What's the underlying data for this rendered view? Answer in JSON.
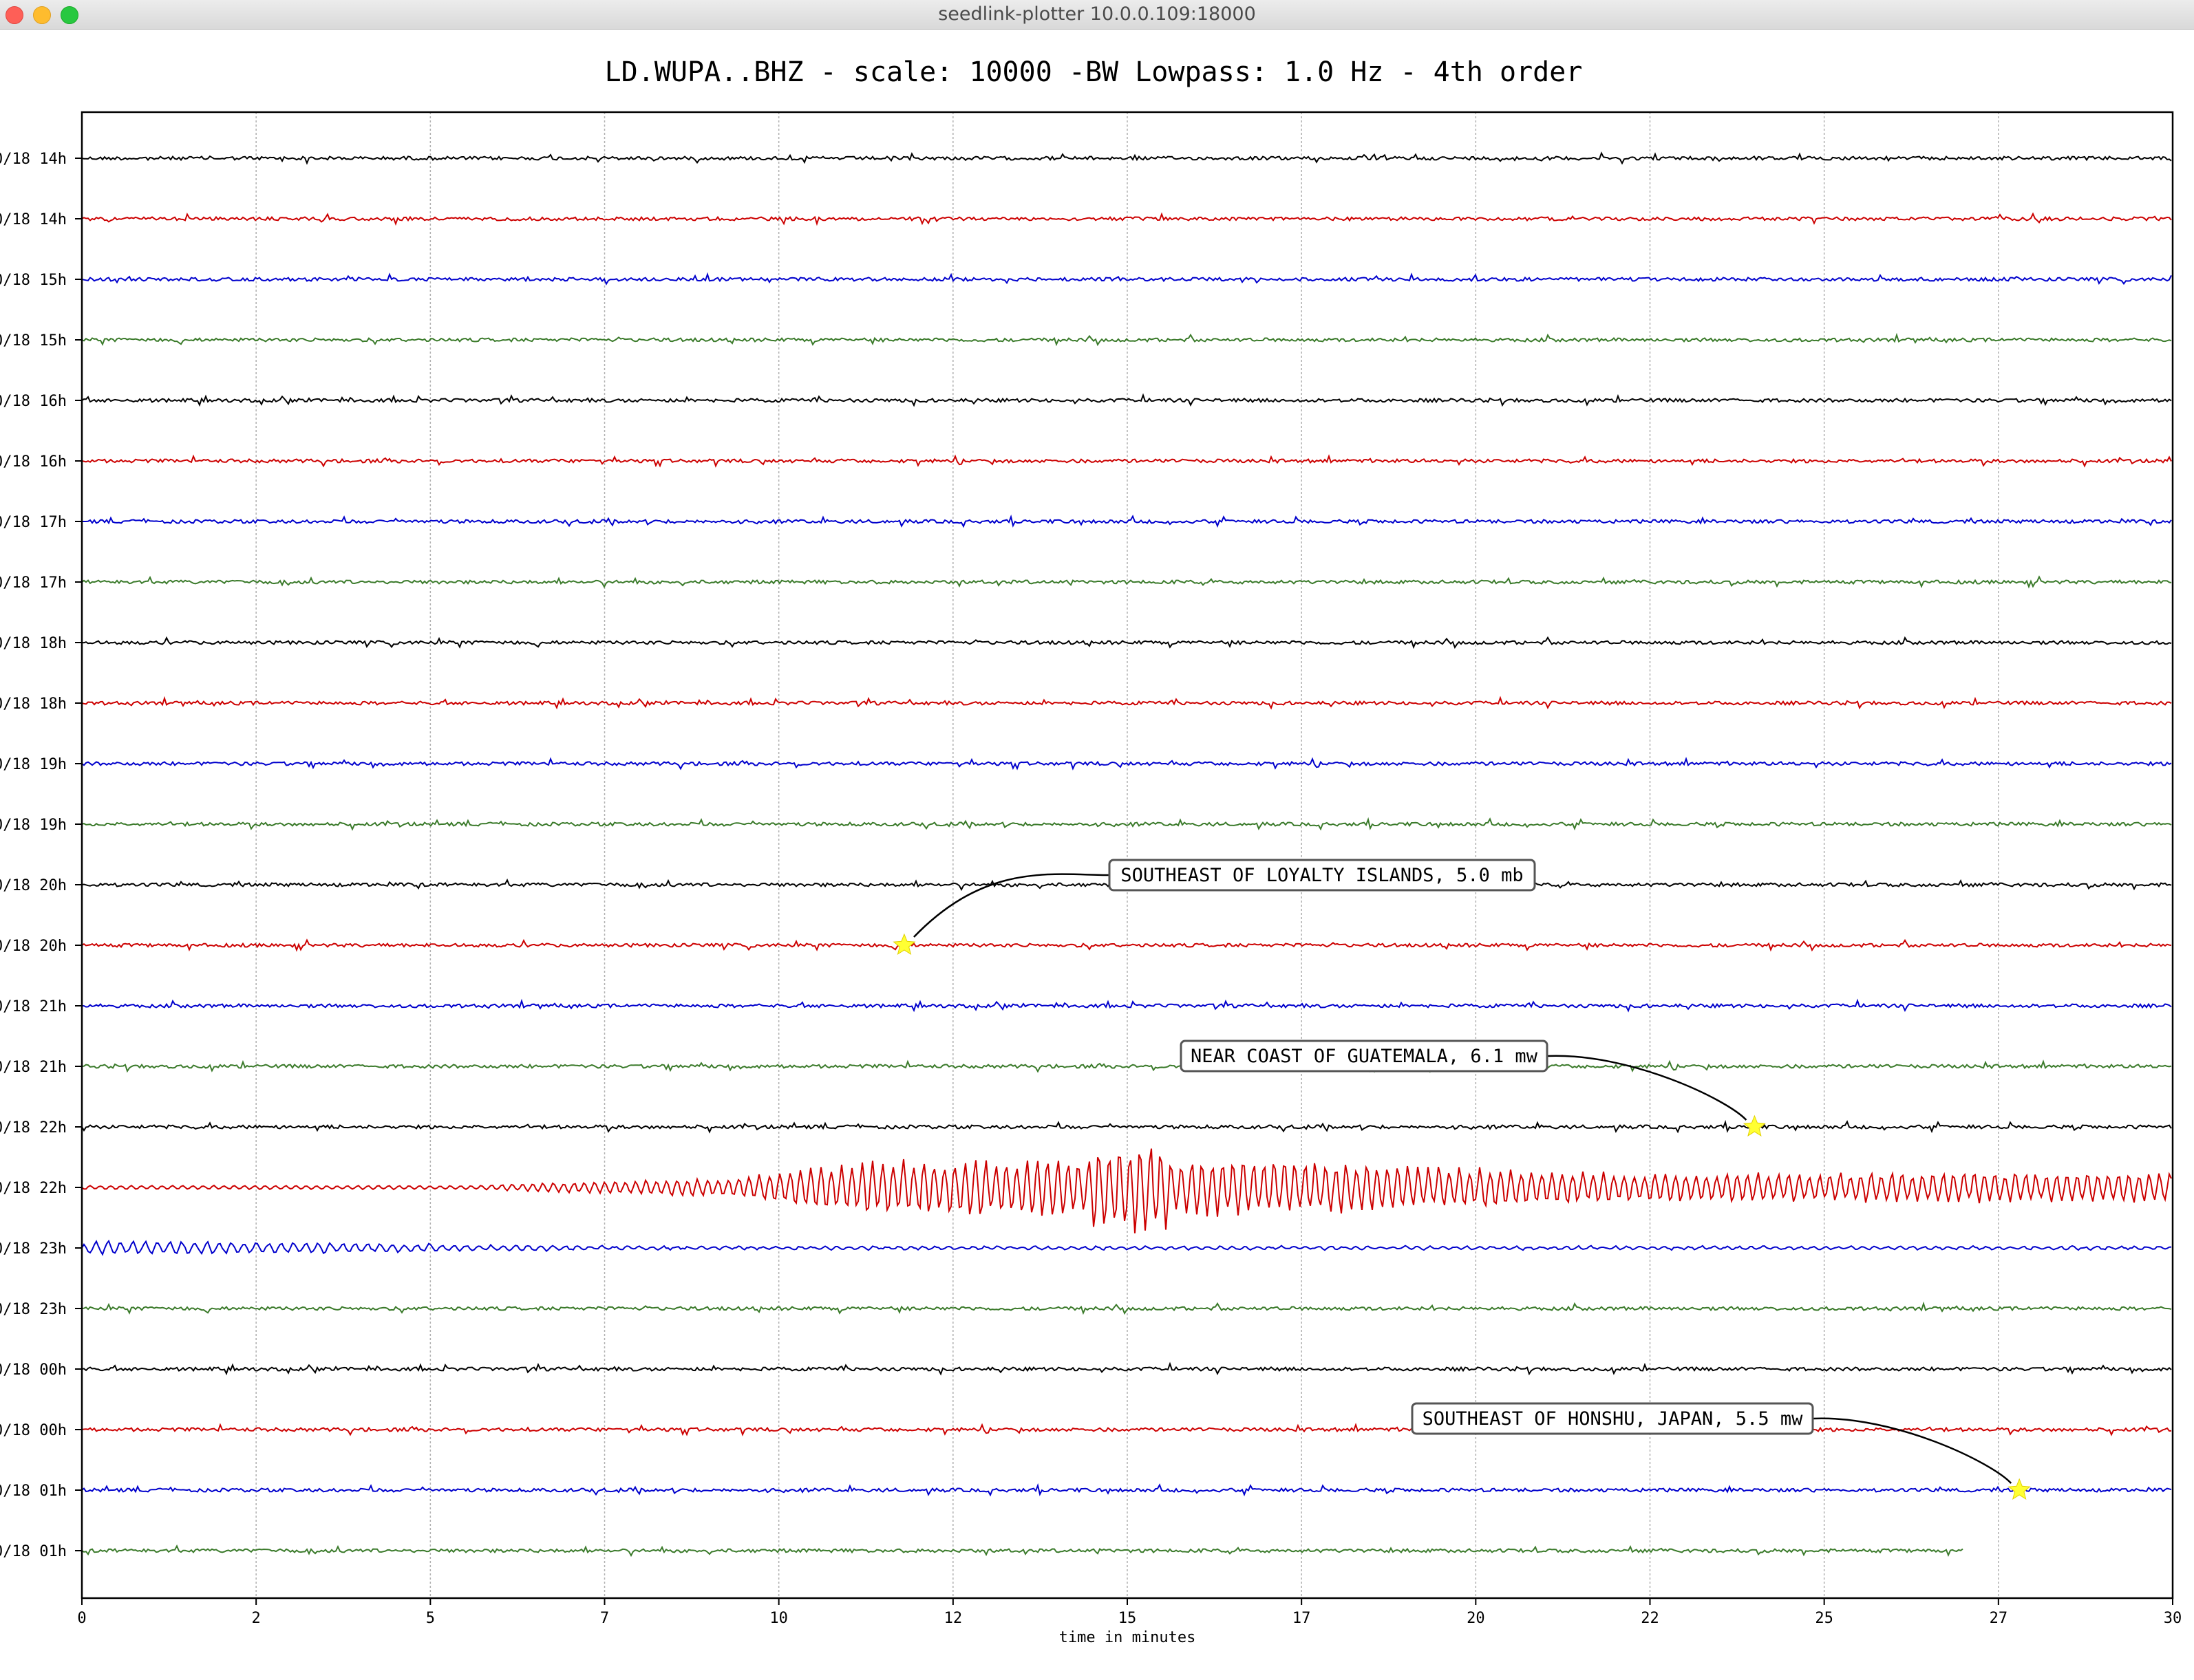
{
  "window": {
    "title": "seedlink-plotter 10.0.0.109:18000"
  },
  "colors": {
    "cycle": [
      "#000000",
      "#cc0000",
      "#0000cc",
      "#3a7a2a"
    ],
    "marker": "#ffff33"
  },
  "chart_data": {
    "type": "line",
    "title": "LD.WUPA..BHZ - scale: 10000 -BW Lowpass: 1.0 Hz - 4th order",
    "xlabel": "time in minutes",
    "xlim": [
      0,
      30
    ],
    "x_ticks": [
      "0",
      "2",
      "5",
      "7",
      "10",
      "12",
      "15",
      "17",
      "20",
      "22",
      "25",
      "27",
      "30"
    ],
    "grid": "vertical",
    "series": [
      {
        "label": "0/18 14h",
        "color": "black",
        "amplitude": "low",
        "end_min": 30
      },
      {
        "label": "0/18 14h",
        "color": "red",
        "amplitude": "low",
        "end_min": 30
      },
      {
        "label": "0/18 15h",
        "color": "blue",
        "amplitude": "low",
        "end_min": 30
      },
      {
        "label": "0/18 15h",
        "color": "green",
        "amplitude": "low",
        "end_min": 30
      },
      {
        "label": "0/18 16h",
        "color": "black",
        "amplitude": "low",
        "end_min": 30
      },
      {
        "label": "0/18 16h",
        "color": "red",
        "amplitude": "low",
        "end_min": 30
      },
      {
        "label": "0/18 17h",
        "color": "blue",
        "amplitude": "low",
        "end_min": 30
      },
      {
        "label": "0/18 17h",
        "color": "green",
        "amplitude": "low",
        "end_min": 30
      },
      {
        "label": "0/18 18h",
        "color": "black",
        "amplitude": "low",
        "end_min": 30
      },
      {
        "label": "0/18 18h",
        "color": "red",
        "amplitude": "low",
        "end_min": 30
      },
      {
        "label": "0/18 19h",
        "color": "blue",
        "amplitude": "low",
        "end_min": 30
      },
      {
        "label": "0/18 19h",
        "color": "green",
        "amplitude": "low",
        "end_min": 30
      },
      {
        "label": "0/18 20h",
        "color": "black",
        "amplitude": "low",
        "end_min": 30
      },
      {
        "label": "0/18 20h",
        "color": "red",
        "amplitude": "low",
        "end_min": 30
      },
      {
        "label": "0/18 21h",
        "color": "blue",
        "amplitude": "low",
        "end_min": 30
      },
      {
        "label": "0/18 21h",
        "color": "green",
        "amplitude": "low",
        "end_min": 30
      },
      {
        "label": "0/18 22h",
        "color": "black",
        "amplitude": "low",
        "end_min": 30
      },
      {
        "label": "0/18 22h",
        "color": "red",
        "amplitude": "earthquake",
        "end_min": 30
      },
      {
        "label": "0/18 23h",
        "color": "blue",
        "amplitude": "coda",
        "end_min": 30
      },
      {
        "label": "0/18 23h",
        "color": "green",
        "amplitude": "low",
        "end_min": 30
      },
      {
        "label": "0/18 00h",
        "color": "black",
        "amplitude": "low",
        "end_min": 30
      },
      {
        "label": "0/18 00h",
        "color": "red",
        "amplitude": "low",
        "end_min": 30
      },
      {
        "label": "0/18 01h",
        "color": "blue",
        "amplitude": "low",
        "end_min": 30
      },
      {
        "label": "0/18 01h",
        "color": "green",
        "amplitude": "low",
        "end_min": 27
      }
    ],
    "annotations": [
      {
        "text": "SOUTHEAST OF LOYALTY ISLANDS, 5.0 mb",
        "row": 13,
        "minute": 11.8
      },
      {
        "text": "NEAR COAST OF GUATEMALA, 6.1 mw",
        "row": 16,
        "minute": 24.0
      },
      {
        "text": "SOUTHEAST OF HONSHU, JAPAN, 5.5 mw",
        "row": 22,
        "minute": 27.8
      }
    ]
  }
}
